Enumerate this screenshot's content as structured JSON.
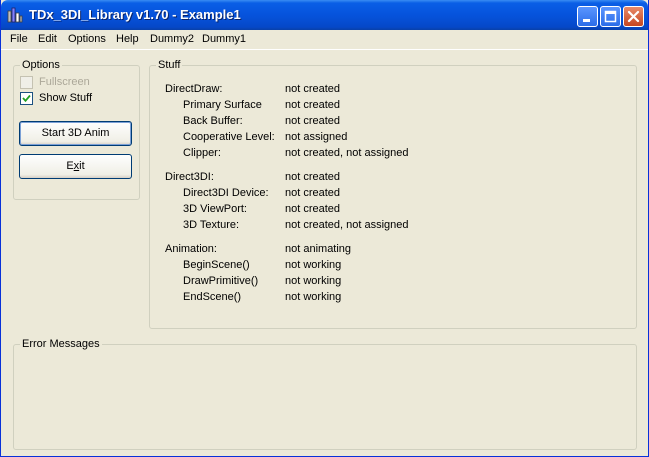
{
  "window": {
    "title": "TDx_3DI_Library v1.70 - Example1"
  },
  "menu": [
    "File",
    "Edit",
    "Options",
    "Help",
    "Dummy2",
    "Dummy1"
  ],
  "options": {
    "title": "Options",
    "fullscreen_label": "Fullscreen",
    "fullscreen_checked": false,
    "fullscreen_enabled": false,
    "show_stuff_label": "Show Stuff",
    "show_stuff_checked": true,
    "start_button": "Start 3D Anim",
    "exit_button": "Exit"
  },
  "stuff": {
    "title": "Stuff",
    "rows": [
      {
        "label": "DirectDraw:",
        "value": "not created",
        "indent": false
      },
      {
        "label": "Primary Surface",
        "value": "not created",
        "indent": true
      },
      {
        "label": "Back Buffer:",
        "value": "not created",
        "indent": true
      },
      {
        "label": "Cooperative Level:",
        "value": "not assigned",
        "indent": true
      },
      {
        "label": "Clipper:",
        "value": "not created, not assigned",
        "indent": true
      },
      {
        "label": "Direct3DI:",
        "value": "not created",
        "indent": false
      },
      {
        "label": "Direct3DI Device:",
        "value": "not created",
        "indent": true
      },
      {
        "label": "3D ViewPort:",
        "value": "not created",
        "indent": true
      },
      {
        "label": "3D Texture:",
        "value": "not created, not assigned",
        "indent": true
      },
      {
        "label": "Animation:",
        "value": "not animating",
        "indent": false
      },
      {
        "label": "BeginScene()",
        "value": "not working",
        "indent": true
      },
      {
        "label": "DrawPrimitive()",
        "value": "not working",
        "indent": true
      },
      {
        "label": "EndScene()",
        "value": "not working",
        "indent": true
      }
    ]
  },
  "errors": {
    "title": "Error Messages"
  },
  "icons": [
    "app-icon",
    "minimize-icon",
    "maximize-icon",
    "close-icon",
    "checkmark-icon"
  ]
}
